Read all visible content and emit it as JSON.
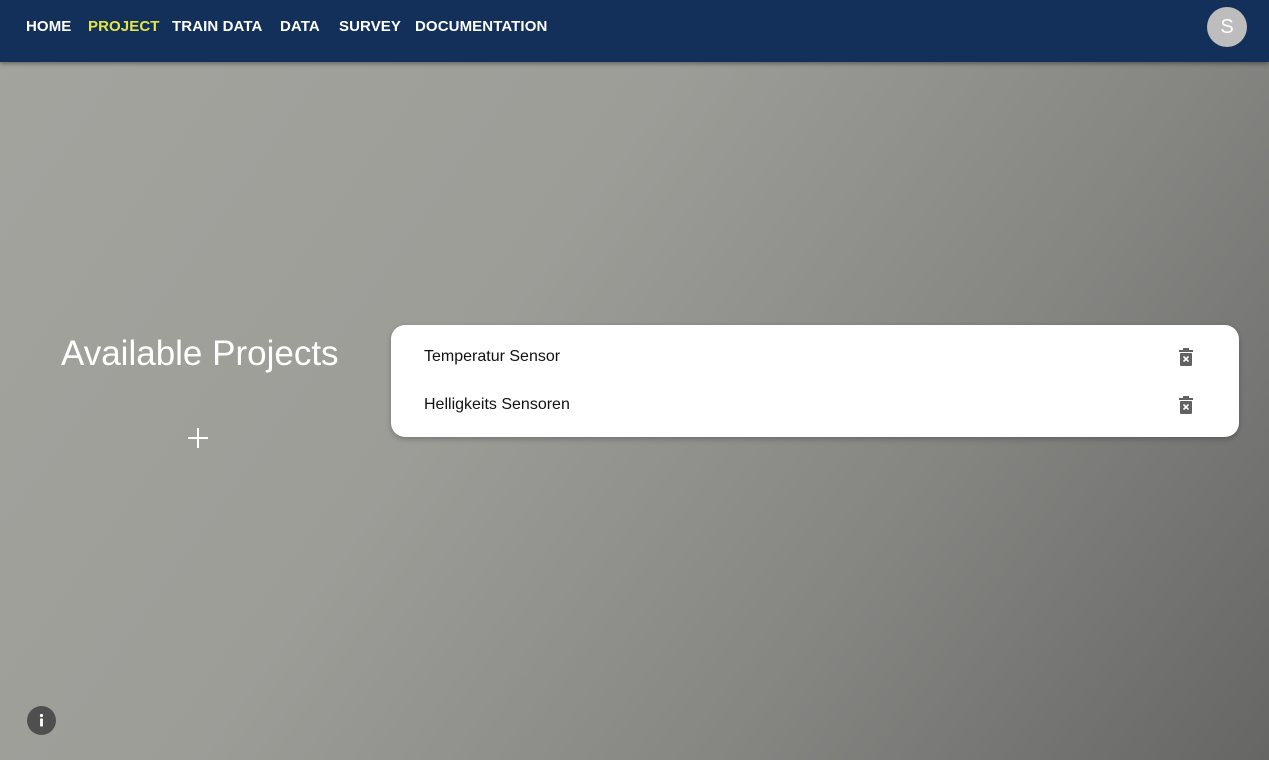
{
  "nav": {
    "items": [
      {
        "label": "HOME",
        "active": false
      },
      {
        "label": "PROJECT",
        "active": true
      },
      {
        "label": "TRAIN DATA",
        "active": false
      },
      {
        "label": "DATA",
        "active": false
      },
      {
        "label": "SURVEY",
        "active": false
      },
      {
        "label": "DOCUMENTATION",
        "active": false
      }
    ],
    "avatar_initial": "S"
  },
  "main": {
    "title": "Available Projects",
    "add_icon": "plus-icon",
    "projects": [
      {
        "name": "Temperatur Sensor",
        "action_icon": "delete-icon"
      },
      {
        "name": "Helligkeits Sensoren",
        "action_icon": "delete-icon"
      }
    ]
  },
  "footer": {
    "info_icon": "info-icon"
  },
  "colors": {
    "navbar": "#13305a",
    "nav_active": "#e1e64a",
    "nav_text": "#ffffff",
    "avatar_bg": "#bdbdbd",
    "card_bg": "#ffffff",
    "icon": "#616161",
    "info_bg": "#4f4f4f"
  }
}
